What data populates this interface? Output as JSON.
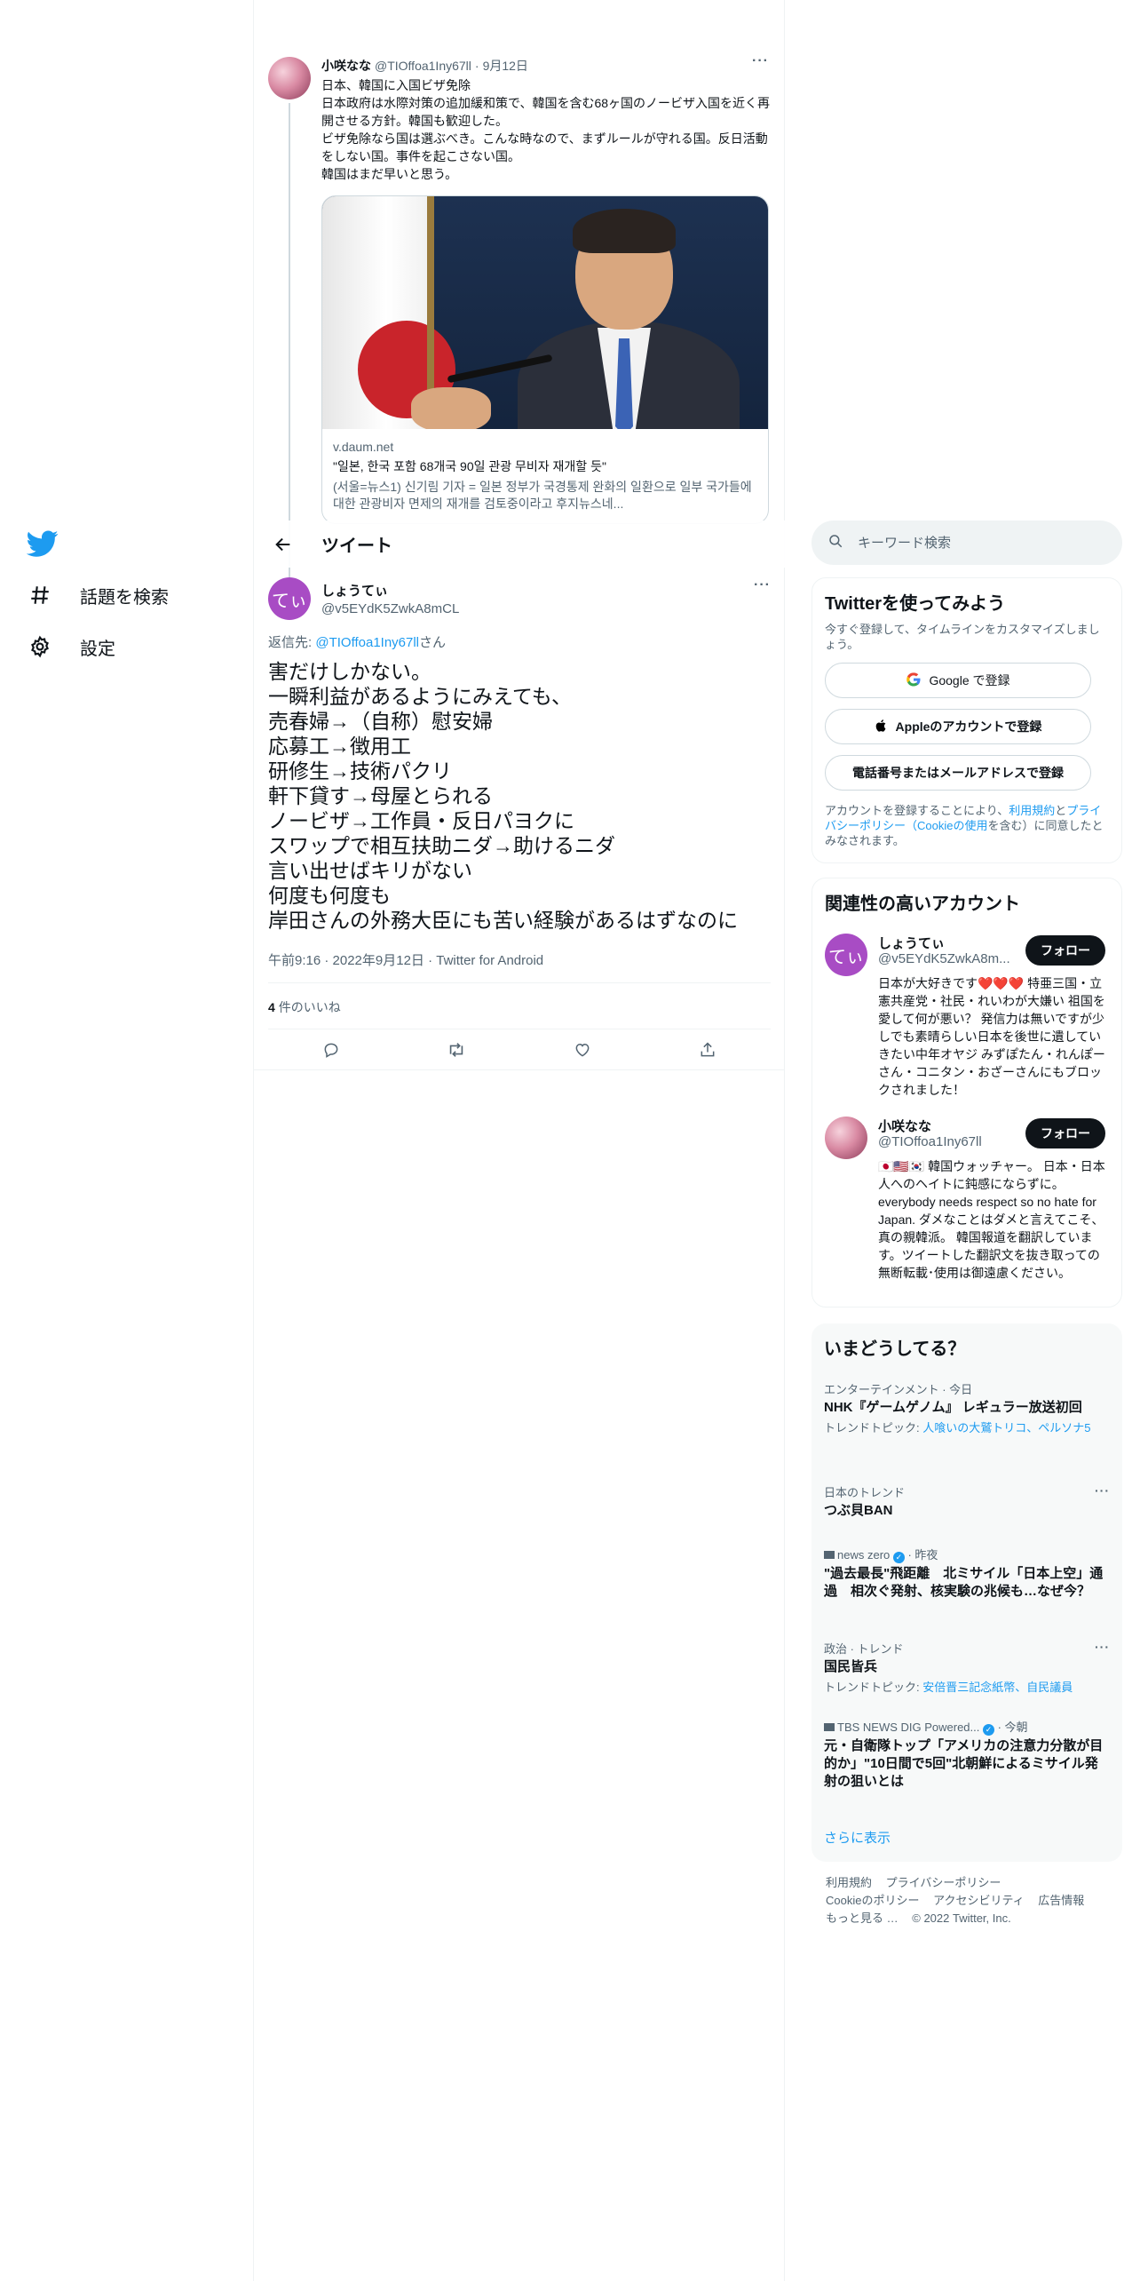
{
  "nav": {
    "logo": "twitter-bird",
    "explore_label": "話題を検索",
    "settings_label": "設定"
  },
  "parent_tweet": {
    "name": "小咲なな",
    "handle": "@TIOffoa1Iny67ll",
    "dot": "·",
    "date": "9月12日",
    "more": "···",
    "text": "日本、韓国に入国ビザ免除\n日本政府は水際対策の追加緩和策で、韓国を含む68ヶ国のノービザ入国を近く再開させる方針。韓国も歓迎した。\nビザ免除なら国は選ぶべき。こんな時なので、まずルールが守れる国。反日活動をしない国。事件を起こさない国。\n韓国はまだ早いと思う。",
    "card": {
      "domain": "v.daum.net",
      "title": "\"일본, 한국 포함 68개국 90일 관광 무비자 재개할 듯\"",
      "description": "(서울=뉴스1) 신기림 기자 = 일본 정부가 국경통제 완화의 일환으로 일부 국가들에 대한 관광비자 면제의 재개를 검토중이라고 후지뉴스네..."
    }
  },
  "header": {
    "title": "ツイート"
  },
  "focus_tweet": {
    "avatar_text": "てぃ",
    "name": "しょうてぃ",
    "handle": "@v5EYdK5ZwkA8mCL",
    "more": "···",
    "reply_prefix": "返信先: ",
    "reply_mention": "@TIOffoa1Iny67ll",
    "reply_suffix": "さん",
    "text": "害だけしかない。\n一瞬利益があるようにみえても、\n売春婦→（自称）慰安婦\n応募工→徴用工\n研修生→技術パクリ\n軒下貸す→母屋とられる\nノービザ→工作員・反日パヨクに\nスワップで相互扶助ニダ→助けるニダ\n言い出せばキリがない\n何度も何度も\n岸田さんの外務大臣にも苦い経験があるはずなのに",
    "meta": "午前9:16 · 2022年9月12日 · Twitter for Android",
    "likes_count": "4",
    "likes_label": "件のいいね"
  },
  "sidebar": {
    "search_placeholder": "キーワード検索",
    "signup": {
      "title": "Twitterを使ってみよう",
      "subtitle": "今すぐ登録して、タイムラインをカスタマイズしましょう。",
      "google_label": "Google で登録",
      "apple_label": "Appleのアカウントで登録",
      "email_label": "電話番号またはメールアドレスで登録",
      "legal_prefix": "アカウントを登録することにより、",
      "legal_terms": "利用規約",
      "legal_and": "と",
      "legal_privacy": "プライバシーポリシー",
      "legal_paren_open": "（",
      "legal_cookie": "Cookieの使用",
      "legal_suffix": "を含む）に同意したとみなされます。"
    },
    "who_to_follow": {
      "title": "関連性の高いアカウント",
      "follow_label": "フォロー",
      "accounts": [
        {
          "avatar_text": "てぃ",
          "name": "しょうてぃ",
          "handle": "@v5EYdK5ZwkA8m...",
          "bio": "日本が大好きです❤️❤️❤️ 特亜三国・立憲共産党・社民・れいわが大嫌い 祖国を愛して何が悪い？ 発信力は無いですが少しでも素晴らしい日本を後世に遺していきたい中年オヤジ みずぽたん・れんぽーさん・コニタン・おざーさんにもブロックされました！"
        },
        {
          "avatar_text": "",
          "name": "小咲なな",
          "handle": "@TIOffoa1Iny67ll",
          "bio": "🇯🇵🇺🇸🇰🇷 韓国ウォッチャー。 日本・日本人へのヘイトに鈍感にならずに。 everybody needs respect so no hate for Japan. ダメなことはダメと言えてこそ、真の親韓派。 韓国報道を翻訳しています。ツイートした翻訳文を抜き取っての無断転載･使用は御遠慮ください。"
        }
      ]
    },
    "trends": {
      "title": "いまどうしてる？",
      "items": [
        {
          "context": "エンターテインメント · 今日",
          "title": "NHK『ゲームゲノム』 レギュラー放送初回",
          "sub_prefix": "トレンドトピック: ",
          "sub_link": "人喰いの大鷲トリコ、ペルソナ5"
        },
        {
          "context": "日本のトレンド",
          "title": "つぶ貝BAN",
          "more": "···"
        },
        {
          "context_source": "news zero",
          "context_time": " · 昨夜",
          "title": "\"過去最長\"飛距離　北ミサイル「日本上空」通過　相次ぐ発射、核実験の兆候も…なぜ今？"
        },
        {
          "context": "政治 · トレンド",
          "title": "国民皆兵",
          "sub_prefix": "トレンドトピック: ",
          "sub_link": "安倍晋三記念紙幣、自民議員",
          "more": "···"
        },
        {
          "context_source": "TBS NEWS DIG Powered...",
          "context_time": " · 今朝",
          "title": "元・自衛隊トップ「アメリカの注意力分散が目的か」\"10日間で5回\"北朝鮮によるミサイル発射の狙いとは"
        }
      ],
      "show_more": "さらに表示"
    },
    "footer": [
      "利用規約",
      "プライバシーポリシー",
      "Cookieのポリシー",
      "アクセシビリティ",
      "広告情報",
      "もっと見る …",
      "© 2022 Twitter, Inc."
    ]
  },
  "colors": {
    "accent": "#1d9bf0",
    "text": "#0f1419",
    "muted": "#536471",
    "border": "#eff3f4"
  }
}
